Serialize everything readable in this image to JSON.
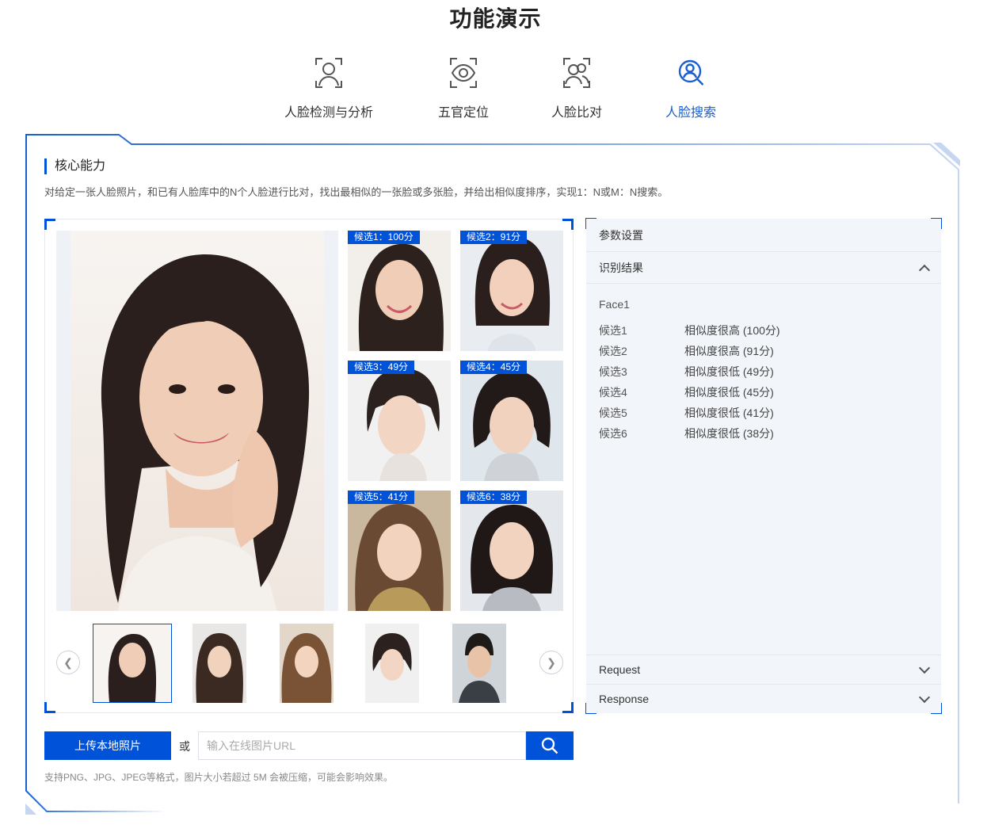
{
  "page": {
    "title": "功能演示"
  },
  "tabs": [
    {
      "label": "人脸检测与分析",
      "icon": "face-scan-icon",
      "active": false
    },
    {
      "label": "五官定位",
      "icon": "eye-scan-icon",
      "active": false
    },
    {
      "label": "人脸比对",
      "icon": "face-compare-icon",
      "active": false
    },
    {
      "label": "人脸搜索",
      "icon": "face-search-icon",
      "active": true
    }
  ],
  "section": {
    "title": "核心能力",
    "description": "对给定一张人脸照片，和已有人脸库中的N个人脸进行比对，找出最相似的一张脸或多张脸，并给出相似度排序，实现1：N或M：N搜索。"
  },
  "candidates": [
    {
      "label": "候选1：100分"
    },
    {
      "label": "候选2：91分"
    },
    {
      "label": "候选3：49分"
    },
    {
      "label": "候选4：45分"
    },
    {
      "label": "候选5：41分"
    },
    {
      "label": "候选6：38分"
    }
  ],
  "thumbnails": {
    "count": 5,
    "selected_index": 0
  },
  "panel": {
    "params_label": "参数设置",
    "result_label": "识别结果",
    "face_label": "Face1",
    "results": [
      {
        "name": "候选1",
        "value": "相似度很高 (100分)"
      },
      {
        "name": "候选2",
        "value": "相似度很高 (91分)"
      },
      {
        "name": "候选3",
        "value": "相似度很低 (49分)"
      },
      {
        "name": "候选4",
        "value": "相似度很低 (45分)"
      },
      {
        "name": "候选5",
        "value": "相似度很低 (41分)"
      },
      {
        "name": "候选6",
        "value": "相似度很低 (38分)"
      }
    ],
    "request_label": "Request",
    "response_label": "Response"
  },
  "upload": {
    "button_label": "上传本地照片",
    "or_label": "或",
    "url_placeholder": "输入在线图片URL",
    "hint": "支持PNG、JPG、JPEG等格式，图片大小若超过 5M 会被压缩，可能会影响效果。"
  },
  "colors": {
    "accent": "#0052d9",
    "panel_bg": "#f2f5fa"
  }
}
